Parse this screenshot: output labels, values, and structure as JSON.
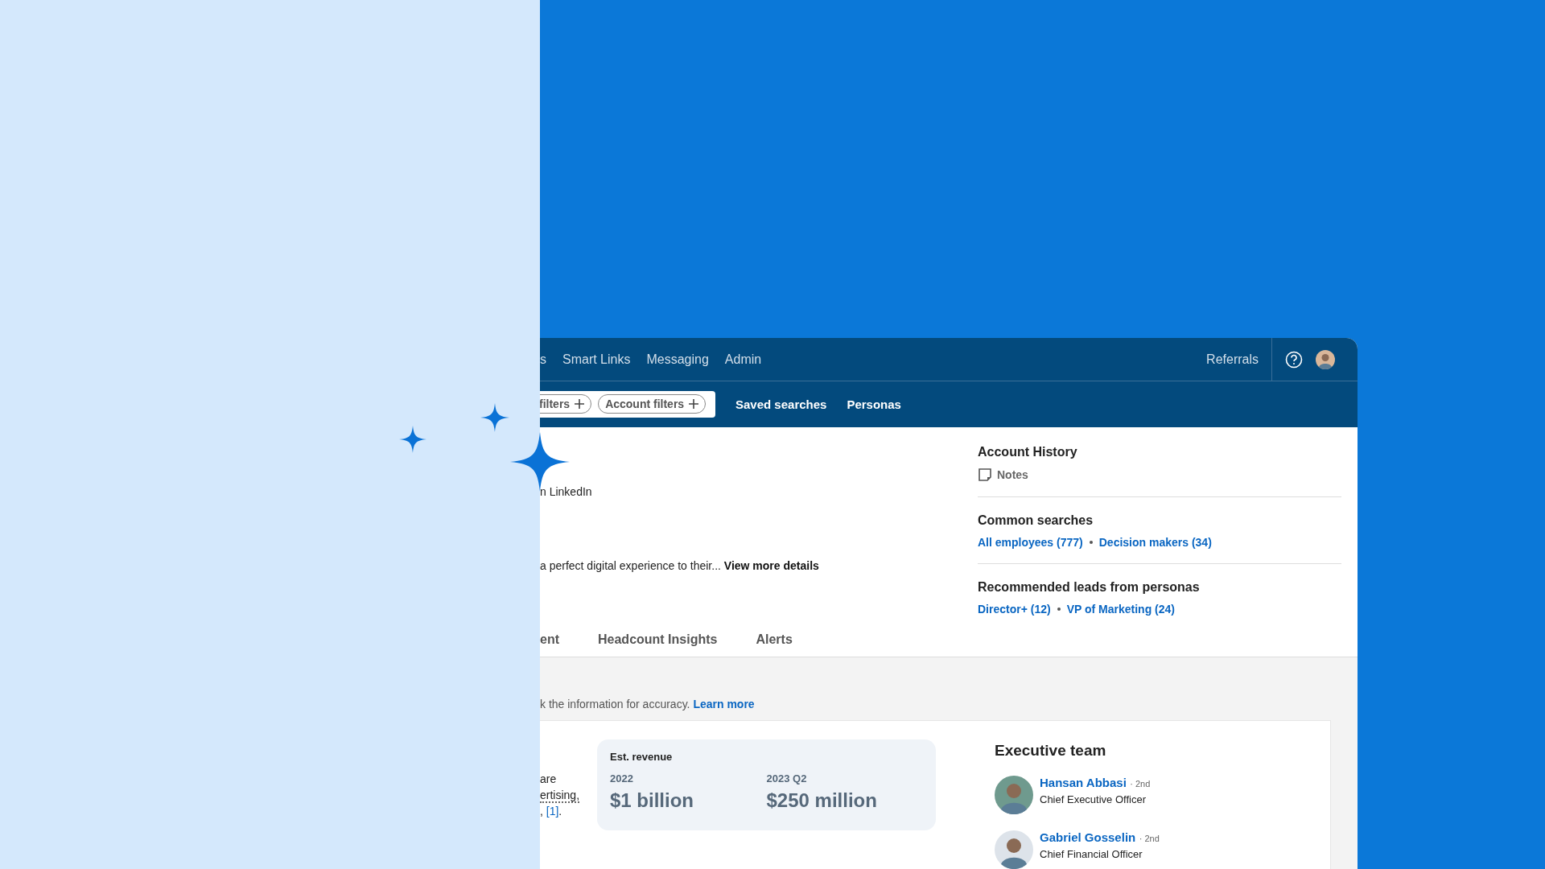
{
  "nav": {
    "items": [
      {
        "label": "s"
      },
      {
        "label": "Smart Links"
      },
      {
        "label": "Messaging"
      },
      {
        "label": "Admin"
      }
    ],
    "referrals": "Referrals"
  },
  "subbar": {
    "chips": [
      "filters",
      "Account filters"
    ],
    "links": [
      "Saved searches",
      "Personas"
    ]
  },
  "account": {
    "source": "n LinkedIn",
    "description": "a perfect digital experience to their...",
    "more": "View more details"
  },
  "tabs": [
    {
      "label": "ent"
    },
    {
      "label": "Headcount Insights"
    },
    {
      "label": "Alerts"
    }
  ],
  "side": {
    "history_title": "Account History",
    "notes": "Notes",
    "sections": [
      {
        "title": "Common searches",
        "links": [
          "All employees (777)",
          "Decision makers (34)"
        ]
      },
      {
        "title": "Recommended leads from personas",
        "links": [
          "Director+ (12)",
          "VP of Marketing (24)"
        ]
      }
    ]
  },
  "notice": {
    "text": "k the information for accuracy.",
    "link": "Learn more"
  },
  "overview_lines": [
    {
      "kind": "plain",
      "text": "are"
    },
    {
      "kind": "term",
      "text": "ertising,"
    },
    {
      "kind": "cite",
      "before": ",",
      "ref": "[1]",
      "after": "."
    }
  ],
  "revenue": {
    "title": "Est. revenue",
    "periods": [
      {
        "label": "2022",
        "value": "$1 billion"
      },
      {
        "label": "2023 Q2",
        "value": "$250 million"
      }
    ]
  },
  "executives": {
    "title": "Executive team",
    "people": [
      {
        "name": "Hansan Abbasi",
        "degree": "· 2nd",
        "role": "Chief Executive Officer"
      },
      {
        "name": "Gabriel Gosselin",
        "degree": "· 2nd",
        "role": "Chief Financial Officer"
      }
    ]
  }
}
